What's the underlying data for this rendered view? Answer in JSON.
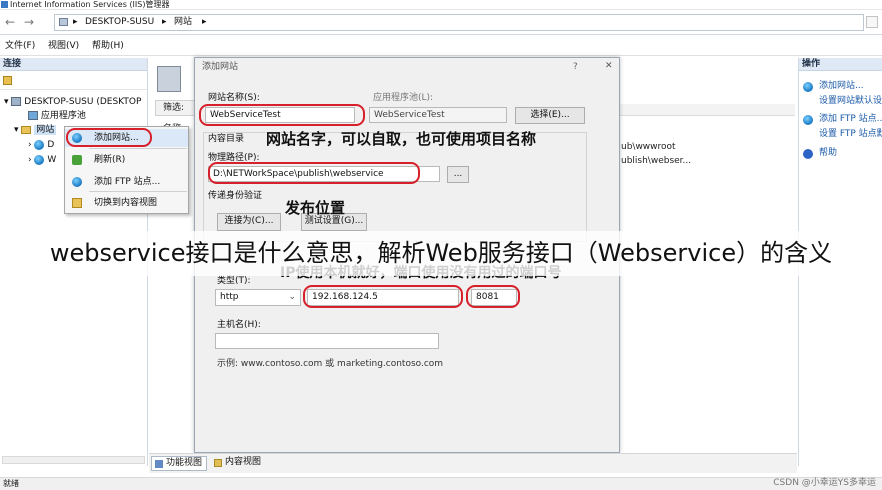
{
  "window": {
    "title": "Internet Information Services (IIS)管理器"
  },
  "address": {
    "segments": [
      "DESKTOP-SUSU",
      "网站"
    ]
  },
  "menu": [
    "文件(F)",
    "视图(V)",
    "帮助(H)"
  ],
  "connections": {
    "title": "连接",
    "tree": {
      "server": "DESKTOP-SUSU (DESKTOP",
      "app_pools": "应用程序池",
      "sites": "网站",
      "child_1_prefix": "D",
      "child_2_prefix": "W"
    }
  },
  "context_menu": {
    "items": [
      "添加网站...",
      "刷新(R)",
      "添加 FTP 站点...",
      "切换到内容视图"
    ]
  },
  "center": {
    "filter_label": "筛选:",
    "name_col": "名称",
    "row1_path": "ub\\wwwroot",
    "row2_path": "ublish\\webser..."
  },
  "actions": {
    "title": "操作",
    "items": [
      "添加网站...",
      "设置网站默认设",
      "添加 FTP 站点...",
      "设置 FTP 站点默",
      "帮助"
    ]
  },
  "dialog": {
    "title": "添加网站",
    "help": "?",
    "close": "✕",
    "site_name_label": "网站名称(S):",
    "site_name_value": "WebServiceTest",
    "app_pool_label": "应用程序池(L):",
    "app_pool_value": "WebServiceTest",
    "select_button": "选择(E)...",
    "content_dir_label": "内容目录",
    "physical_path_label": "物理路径(P):",
    "physical_path_value": "D:\\NETWorkSpace\\publish\\webservice",
    "browse_button": "...",
    "pass_auth_label": "传递身份验证",
    "connect_as_button": "连接为(C)...",
    "test_settings_button": "测试设置(G)...",
    "type_label": "类型(T):",
    "type_value": "http",
    "ip_value": "192.168.124.5",
    "port_value": "8081",
    "host_label": "主机名(H):",
    "host_value": "",
    "example_text": "示例: www.contoso.com 或 marketing.contoso.com"
  },
  "annotations": {
    "site_name_note": "网站名字，可以自取，也可使用项目名称",
    "publish_note": "发布位置",
    "ip_note": "IP使用本机就好，端口使用没有用过的端口号"
  },
  "overlay_caption": "webservice接口是什么意思，解析Web服务接口（Webservice）的含义",
  "bottom_tabs": [
    "功能视图",
    "内容视图"
  ],
  "status": "就绪",
  "watermark": "CSDN @小幸运YS多幸运",
  "colors": {
    "annotation_red": "#d8202a",
    "panel_header": "#dfe9f5",
    "link_blue": "#1a5aa8"
  }
}
